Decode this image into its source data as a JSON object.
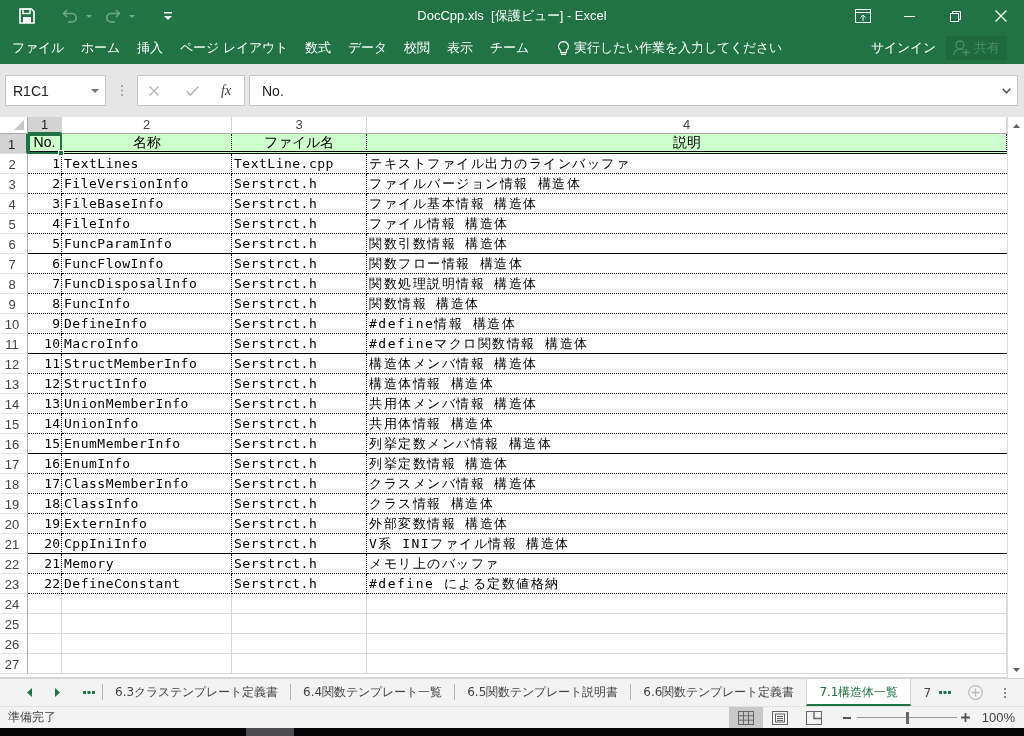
{
  "window": {
    "title": "DocCpp.xls  [保護ビュー] - Excel"
  },
  "ribbon": {
    "tabs": [
      "ファイル",
      "ホーム",
      "挿入",
      "ページ レイアウト",
      "数式",
      "データ",
      "校閲",
      "表示",
      "チーム"
    ],
    "tell_me": "実行したい作業を入力してください",
    "sign_in": "サインイン",
    "share": {
      "label": "共有",
      "disabled": true
    }
  },
  "formula_bar": {
    "name_box": "R1C1",
    "insert_function": "fx",
    "formula": "No."
  },
  "sheet": {
    "columns": [
      {
        "label": "1",
        "selected": true
      },
      {
        "label": "2",
        "selected": false
      },
      {
        "label": "3",
        "selected": false
      },
      {
        "label": "4",
        "selected": false
      }
    ],
    "header_row": {
      "row_label": "1",
      "selected": true,
      "cells": [
        "No.",
        "名称",
        "ファイル名",
        "説明"
      ]
    },
    "rows": [
      {
        "row_label": "2",
        "selected": false,
        "cells": [
          "1",
          "TextLines",
          "TextLine.cpp",
          "テキストファイル出力のラインバッファ"
        ],
        "solid_bottom_border": false
      },
      {
        "row_label": "3",
        "selected": false,
        "cells": [
          "2",
          "FileVersionInfo",
          "Serstrct.h",
          "ファイルバージョン情報 構造体"
        ],
        "solid_bottom_border": false
      },
      {
        "row_label": "4",
        "selected": false,
        "cells": [
          "3",
          "FileBaseInfo",
          "Serstrct.h",
          "ファイル基本情報 構造体"
        ],
        "solid_bottom_border": false
      },
      {
        "row_label": "5",
        "selected": false,
        "cells": [
          "4",
          "FileInfo",
          "Serstrct.h",
          "ファイル情報 構造体"
        ],
        "solid_bottom_border": false
      },
      {
        "row_label": "6",
        "selected": false,
        "cells": [
          "5",
          "FuncParamInfo",
          "Serstrct.h",
          "関数引数情報 構造体"
        ],
        "solid_bottom_border": true
      },
      {
        "row_label": "7",
        "selected": false,
        "cells": [
          "6",
          "FuncFlowInfo",
          "Serstrct.h",
          "関数フロー情報 構造体"
        ],
        "solid_bottom_border": false
      },
      {
        "row_label": "8",
        "selected": false,
        "cells": [
          "7",
          "FuncDisposalInfo",
          "Serstrct.h",
          "関数処理説明情報 構造体"
        ],
        "solid_bottom_border": false
      },
      {
        "row_label": "9",
        "selected": false,
        "cells": [
          "8",
          "FuncInfo",
          "Serstrct.h",
          "関数情報 構造体"
        ],
        "solid_bottom_border": false
      },
      {
        "row_label": "10",
        "selected": false,
        "cells": [
          "9",
          "DefineInfo",
          "Serstrct.h",
          "#define情報 構造体"
        ],
        "solid_bottom_border": false
      },
      {
        "row_label": "11",
        "selected": false,
        "cells": [
          "10",
          "MacroInfo",
          "Serstrct.h",
          "#defineマクロ関数情報 構造体"
        ],
        "solid_bottom_border": true
      },
      {
        "row_label": "12",
        "selected": false,
        "cells": [
          "11",
          "StructMemberInfo",
          "Serstrct.h",
          "構造体メンバ情報 構造体"
        ],
        "solid_bottom_border": false
      },
      {
        "row_label": "13",
        "selected": false,
        "cells": [
          "12",
          "StructInfo",
          "Serstrct.h",
          "構造体情報 構造体"
        ],
        "solid_bottom_border": false
      },
      {
        "row_label": "14",
        "selected": false,
        "cells": [
          "13",
          "UnionMemberInfo",
          "Serstrct.h",
          "共用体メンバ情報 構造体"
        ],
        "solid_bottom_border": false
      },
      {
        "row_label": "15",
        "selected": false,
        "cells": [
          "14",
          "UnionInfo",
          "Serstrct.h",
          "共用体情報 構造体"
        ],
        "solid_bottom_border": false
      },
      {
        "row_label": "16",
        "selected": false,
        "cells": [
          "15",
          "EnumMemberInfo",
          "Serstrct.h",
          "列挙定数メンバ情報 構造体"
        ],
        "solid_bottom_border": true
      },
      {
        "row_label": "17",
        "selected": false,
        "cells": [
          "16",
          "EnumInfo",
          "Serstrct.h",
          "列挙定数情報 構造体"
        ],
        "solid_bottom_border": false
      },
      {
        "row_label": "18",
        "selected": false,
        "cells": [
          "17",
          "ClassMemberInfo",
          "Serstrct.h",
          "クラスメンバ情報 構造体"
        ],
        "solid_bottom_border": false
      },
      {
        "row_label": "19",
        "selected": false,
        "cells": [
          "18",
          "ClassInfo",
          "Serstrct.h",
          "クラス情報 構造体"
        ],
        "solid_bottom_border": false
      },
      {
        "row_label": "20",
        "selected": false,
        "cells": [
          "19",
          "ExternInfo",
          "Serstrct.h",
          "外部変数情報 構造体"
        ],
        "solid_bottom_border": false
      },
      {
        "row_label": "21",
        "selected": false,
        "cells": [
          "20",
          "CppIniInfo",
          "Serstrct.h",
          "V系 INIファイル情報 構造体"
        ],
        "solid_bottom_border": true
      },
      {
        "row_label": "22",
        "selected": false,
        "cells": [
          "21",
          "Memory",
          "Serstrct.h",
          "メモリ上のバッファ"
        ],
        "solid_bottom_border": false
      },
      {
        "row_label": "23",
        "selected": false,
        "cells": [
          "22",
          "DefineConstant",
          "Serstrct.h",
          "#define による定数値格納"
        ],
        "solid_bottom_border": false
      }
    ],
    "empty_rows": [
      {
        "row_label": "24",
        "selected": false
      },
      {
        "row_label": "25",
        "selected": false
      },
      {
        "row_label": "26",
        "selected": false
      },
      {
        "row_label": "27",
        "selected": false
      }
    ]
  },
  "sheet_tabs": [
    {
      "label": "6.3クラステンプレート定義書",
      "selected": false
    },
    {
      "label": "6.4関数テンプレート一覧",
      "selected": false
    },
    {
      "label": "6.5関数テンプレート説明書",
      "selected": false
    },
    {
      "label": "6.6関数テンプレート定義書",
      "selected": false
    },
    {
      "label": "7.1構造体一覧",
      "selected": true
    },
    {
      "label": "7",
      "selected": false
    }
  ],
  "status_bar": {
    "status": "準備完了",
    "views": [
      {
        "kind": "normal",
        "selected": true
      },
      {
        "kind": "page_layout",
        "selected": false
      },
      {
        "kind": "page_break",
        "selected": false
      }
    ],
    "zoom": {
      "level": 0.5,
      "reading": "100%"
    }
  }
}
